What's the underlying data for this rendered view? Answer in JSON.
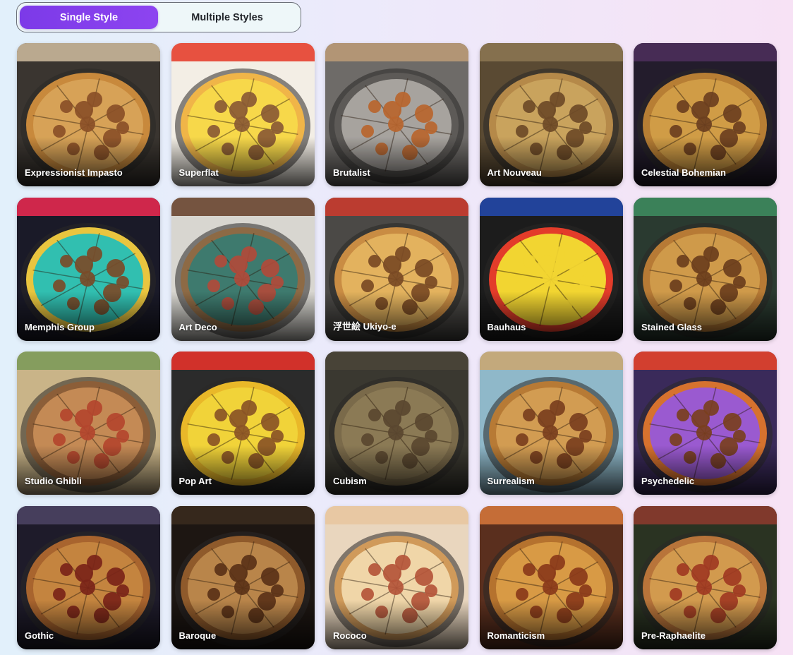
{
  "style_toggle": {
    "options": [
      {
        "label": "Single Style",
        "active": true
      },
      {
        "label": "Multiple Styles",
        "active": false
      }
    ],
    "accent_color": "#7c3ae8"
  },
  "styles": [
    {
      "label": "Expressionist Impasto",
      "bg": "#3a3530",
      "crust": "#c8893c",
      "cheese": "#d7a257",
      "topping": "#8a4f27",
      "box": "#c9b69a"
    },
    {
      "label": "Superflat",
      "bg": "#f3eee5",
      "crust": "#f0b548",
      "cheese": "#f7d84a",
      "topping": "#8a5a34",
      "box": "#e63f2e"
    },
    {
      "label": "Brutalist",
      "bg": "#6e6b68",
      "crust": "#5d5a57",
      "cheese": "#a7a39e",
      "topping": "#b8652e",
      "box": "#b99a77"
    },
    {
      "label": "Art Nouveau",
      "bg": "#5a4a33",
      "crust": "#b58949",
      "cheese": "#c9a35d",
      "topping": "#6e4a27",
      "box": "#8a7451"
    },
    {
      "label": "Celestial Bohemian",
      "bg": "#231c2c",
      "crust": "#b77e34",
      "cheese": "#d09c46",
      "topping": "#6b3f1f",
      "box": "#4b2f5a"
    },
    {
      "label": "Memphis Group",
      "bg": "#1a1a28",
      "crust": "#e9c53f",
      "cheese": "#31bfb0",
      "topping": "#7a4b28",
      "box": "#e3294f"
    },
    {
      "label": "Art Deco",
      "bg": "#d8d6d0",
      "crust": "#8d6a45",
      "cheese": "#3e7a6e",
      "topping": "#b04a3a",
      "box": "#6a4630"
    },
    {
      "label": "浮世絵 Ukiyo-e",
      "bg": "#4b4946",
      "crust": "#c98c43",
      "cheese": "#e3b25e",
      "topping": "#7a4a24",
      "box": "#c83b2e"
    },
    {
      "label": "Bauhaus",
      "bg": "#1c1c1c",
      "crust": "#e33c2a",
      "cheese": "#f2d531",
      "topping": "#f2d531",
      "box": "#2348a8"
    },
    {
      "label": "Stained Glass",
      "bg": "#2a3a30",
      "crust": "#b77a35",
      "cheese": "#cf9a4a",
      "topping": "#6b3e1c",
      "box": "#3d8a5e"
    },
    {
      "label": "Studio Ghibli",
      "bg": "#c9b488",
      "crust": "#8c5e38",
      "cheese": "#c48a55",
      "topping": "#b3452e",
      "box": "#7d9a5a"
    },
    {
      "label": "Pop Art",
      "bg": "#2b2b2b",
      "crust": "#e9b829",
      "cheese": "#f1d339",
      "topping": "#8a5426",
      "box": "#e3322a"
    },
    {
      "label": "Cubism",
      "bg": "#3a3830",
      "crust": "#7a6a4a",
      "cheese": "#8b7a55",
      "topping": "#5a4630",
      "box": "#4a4538"
    },
    {
      "label": "Surrealism",
      "bg": "#8fb8c9",
      "crust": "#b77a35",
      "cheese": "#d29c52",
      "topping": "#7a3f1e",
      "box": "#c9a773"
    },
    {
      "label": "Psychedelic",
      "bg": "#3a2a5a",
      "crust": "#d6722e",
      "cheese": "#9a5ad0",
      "topping": "#7a3f1e",
      "box": "#e3412a"
    },
    {
      "label": "Gothic",
      "bg": "#1e1b2a",
      "crust": "#a8642e",
      "cheese": "#c4843f",
      "topping": "#7a2418",
      "box": "#4a4262"
    },
    {
      "label": "Baroque",
      "bg": "#1d1612",
      "crust": "#8f5a2b",
      "cheese": "#b9854a",
      "topping": "#5a3217",
      "box": "#3a2a1e"
    },
    {
      "label": "Rococo",
      "bg": "#e9d6be",
      "crust": "#d09a5a",
      "cheese": "#f0d6a8",
      "topping": "#b4553a",
      "box": "#e8c7a0"
    },
    {
      "label": "Romanticism",
      "bg": "#5a2f1e",
      "crust": "#b5722e",
      "cheese": "#d89a45",
      "topping": "#8a3a1a",
      "box": "#d0743a"
    },
    {
      "label": "Pre-Raphaelite",
      "bg": "#2a3322",
      "crust": "#b8743a",
      "cheese": "#d29a4e",
      "topping": "#a03a22",
      "box": "#8a3a2e"
    }
  ]
}
